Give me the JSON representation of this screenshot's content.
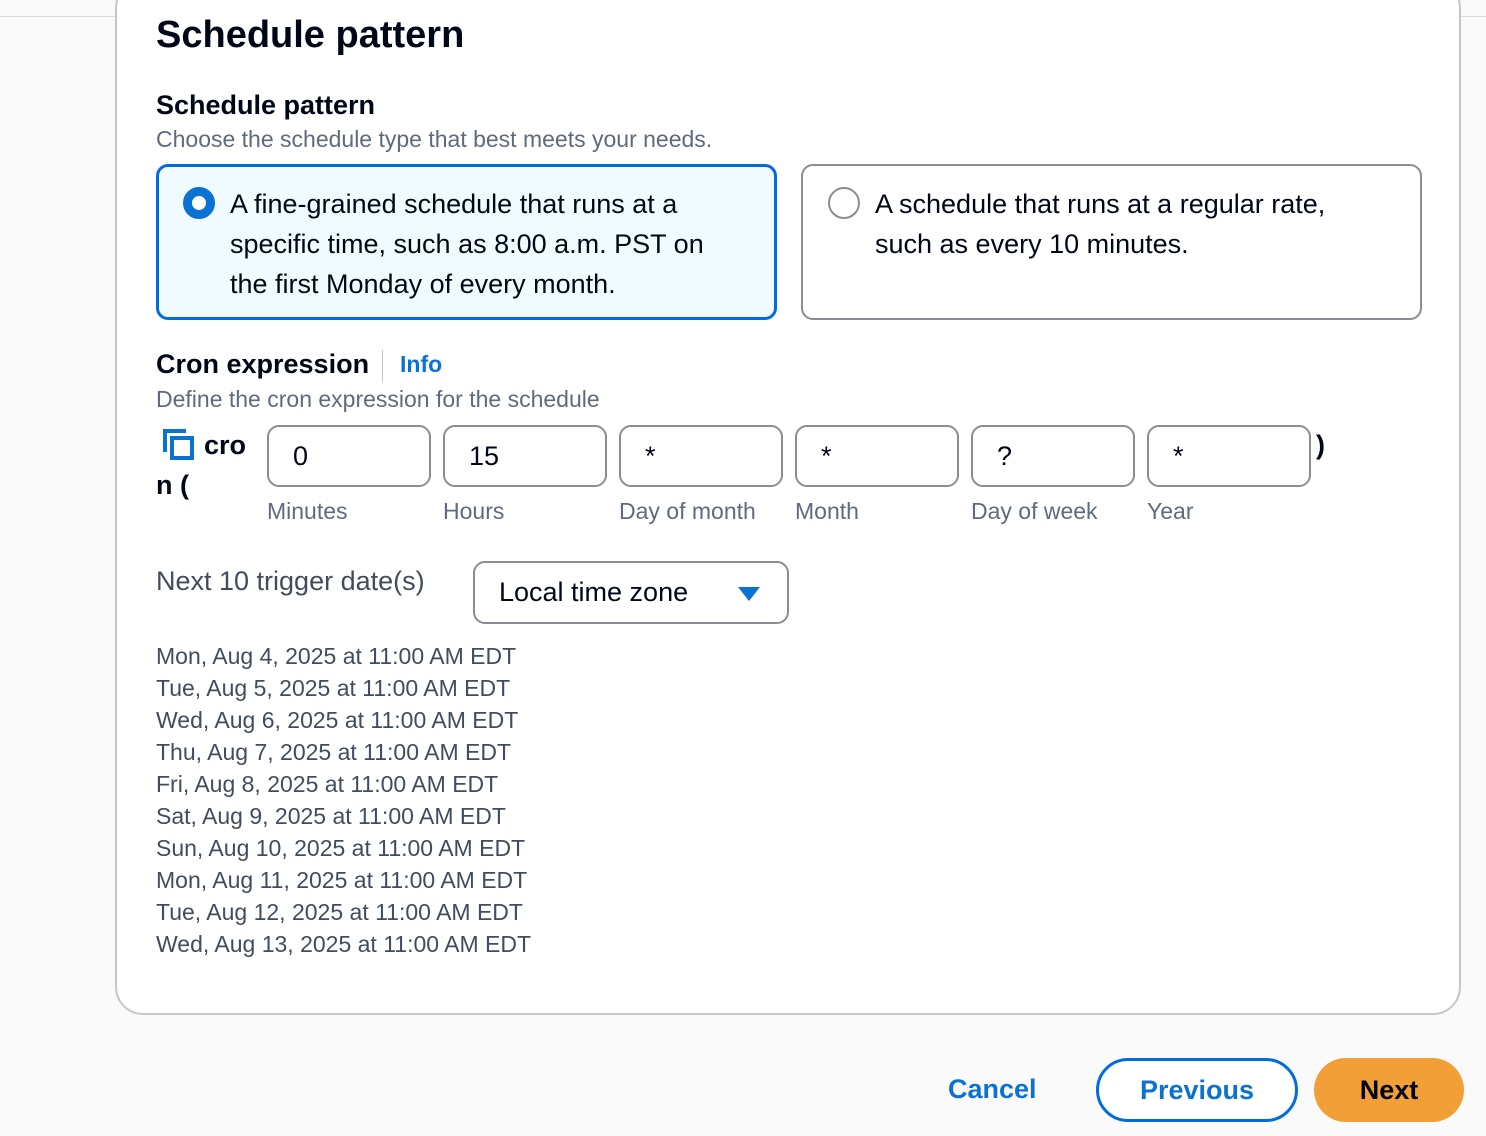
{
  "section": {
    "title": "Schedule pattern"
  },
  "schedule_pattern": {
    "label": "Schedule pattern",
    "description": "Choose the schedule type that best meets your needs.",
    "options": [
      {
        "line1": "A fine-grained schedule that runs at a",
        "line2": "specific time, such as 8:00 a.m. PST on",
        "line3": "the first Monday of every month.",
        "selected": true
      },
      {
        "line1": "A schedule that runs at a regular rate,",
        "line2": "such as every 10 minutes.",
        "selected": false
      }
    ]
  },
  "cron": {
    "label": "Cron expression",
    "info": "Info",
    "description": "Define the cron expression for the schedule",
    "prefix_line1": "cro",
    "prefix_line2": "n (",
    "suffix": ")",
    "fields": [
      {
        "value": "0",
        "label": "Minutes"
      },
      {
        "value": "15",
        "label": "Hours"
      },
      {
        "value": "*",
        "label": "Day of month"
      },
      {
        "value": "*",
        "label": "Month"
      },
      {
        "value": "?",
        "label": "Day of week"
      },
      {
        "value": "*",
        "label": "Year"
      }
    ]
  },
  "trigger": {
    "label": "Next 10 trigger date(s)",
    "timezone": "Local time zone",
    "dates": [
      "Mon, Aug 4, 2025 at 11:00 AM EDT",
      "Tue, Aug 5, 2025 at 11:00 AM EDT",
      "Wed, Aug 6, 2025 at 11:00 AM EDT",
      "Thu, Aug 7, 2025 at 11:00 AM EDT",
      "Fri, Aug 8, 2025 at 11:00 AM EDT",
      "Sat, Aug 9, 2025 at 11:00 AM EDT",
      "Sun, Aug 10, 2025 at 11:00 AM EDT",
      "Mon, Aug 11, 2025 at 11:00 AM EDT",
      "Tue, Aug 12, 2025 at 11:00 AM EDT",
      "Wed, Aug 13, 2025 at 11:00 AM EDT"
    ]
  },
  "footer": {
    "cancel": "Cancel",
    "previous": "Previous",
    "next": "Next"
  },
  "icons": {
    "copy": "copy-icon",
    "dropdown": "caret-down-icon"
  },
  "colors": {
    "accent": "#0972d3",
    "primary_button": "#f19f36",
    "selected_tile_bg": "#f0fbff"
  }
}
